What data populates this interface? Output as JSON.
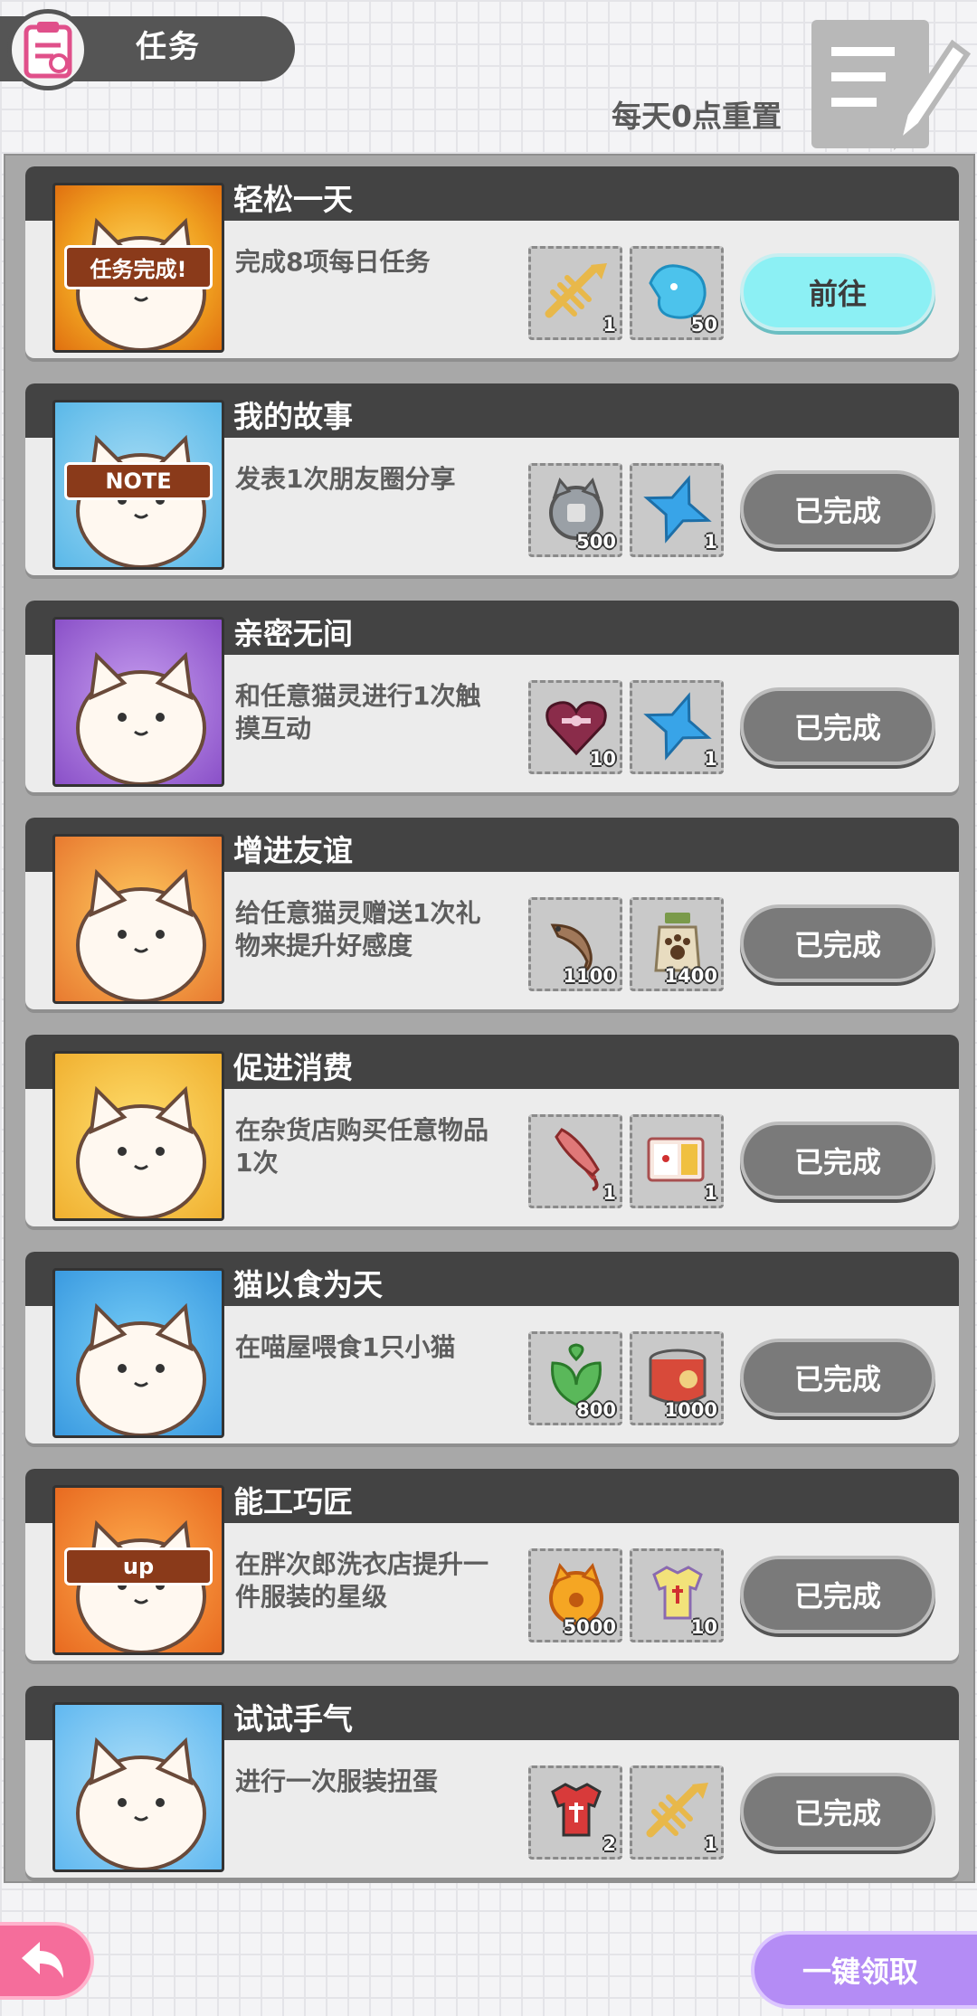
{
  "header": {
    "title": "任务",
    "reset_note": "每天0点重置"
  },
  "tasks": [
    {
      "title": "轻松一天",
      "description": "完成8项每日任务",
      "thumb_label": "任务完成!",
      "rewards": [
        {
          "icon": "fish-bone-icon",
          "count": "1"
        },
        {
          "icon": "blue-slime-icon",
          "count": "50"
        }
      ],
      "button": "前往",
      "state": "go"
    },
    {
      "title": "我的故事",
      "description": "发表1次朋友圈分享",
      "thumb_label": "NOTE",
      "rewards": [
        {
          "icon": "cat-coin-icon",
          "count": "500"
        },
        {
          "icon": "blue-star-icon",
          "count": "1"
        }
      ],
      "button": "已完成",
      "state": "done"
    },
    {
      "title": "亲密无间",
      "description": "和任意猫灵进行1次触摸互动",
      "rewards": [
        {
          "icon": "gift-heart-icon",
          "count": "10"
        },
        {
          "icon": "blue-star-icon",
          "count": "1"
        }
      ],
      "button": "已完成",
      "state": "done"
    },
    {
      "title": "增进友谊",
      "description": "给任意猫灵赠送1次礼物来提升好感度",
      "rewards": [
        {
          "icon": "dried-fish-icon",
          "count": "1100"
        },
        {
          "icon": "paw-jar-icon",
          "count": "1400"
        }
      ],
      "button": "已完成",
      "state": "done"
    },
    {
      "title": "促进消费",
      "description": "在杂货店购买任意物品1次",
      "rewards": [
        {
          "icon": "umbrella-icon",
          "count": "1"
        },
        {
          "icon": "bento-icon",
          "count": "1"
        }
      ],
      "button": "已完成",
      "state": "done"
    },
    {
      "title": "猫以食为天",
      "description": "在喵屋喂食1只小猫",
      "rewards": [
        {
          "icon": "mint-leaf-icon",
          "count": "800"
        },
        {
          "icon": "cat-food-can-icon",
          "count": "1000"
        }
      ],
      "button": "已完成",
      "state": "done"
    },
    {
      "title": "能工巧匠",
      "description": "在胖次郎洗衣店提升一件服装的星级",
      "thumb_label": "up",
      "rewards": [
        {
          "icon": "gold-cat-coin-icon",
          "count": "5000"
        },
        {
          "icon": "cat-shirt-icon",
          "count": "10"
        }
      ],
      "button": "已完成",
      "state": "done"
    },
    {
      "title": "试试手气",
      "description": "进行一次服装扭蛋",
      "rewards": [
        {
          "icon": "red-cat-shirt-icon",
          "count": "2"
        },
        {
          "icon": "fish-bone-icon",
          "count": "1"
        }
      ],
      "button": "已完成",
      "state": "done"
    }
  ],
  "footer": {
    "claim_all": "一键领取"
  },
  "colors": {
    "go_button": "#8cf0f4",
    "done_button": "#7a7a7a",
    "header_bar": "#434343",
    "claim_button": "#b48cf5",
    "back_button": "#f56d9b"
  }
}
